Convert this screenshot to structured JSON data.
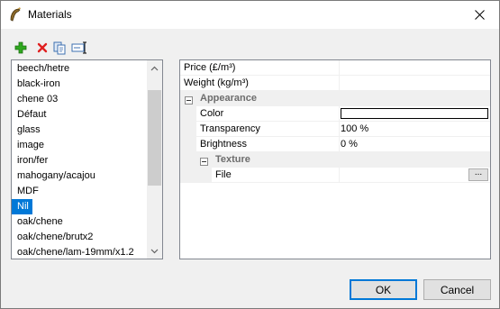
{
  "window": {
    "title": "Materials"
  },
  "toolbar": {
    "buttons": [
      "add-icon",
      "delete-icon",
      "copy-icon",
      "rename-icon"
    ]
  },
  "materials": {
    "items": [
      "beech/hetre",
      "black-iron",
      "chene 03",
      "Défaut",
      "glass",
      "image",
      "iron/fer",
      "mahogany/acajou",
      "MDF",
      "Nil",
      "oak/chene",
      "oak/chene/brutx2",
      "oak/chene/lam-19mm/x1.2"
    ],
    "selected": "Nil"
  },
  "properties": {
    "price_label": "Price (£/m³)",
    "price_value": "",
    "weight_label": "Weight (kg/m³)",
    "weight_value": "",
    "appearance_label": "Appearance",
    "color_label": "Color",
    "color_value": "#ffffff",
    "transparency_label": "Transparency",
    "transparency_value": "100 %",
    "brightness_label": "Brightness",
    "brightness_value": "0 %",
    "texture_label": "Texture",
    "file_label": "File",
    "file_value": "",
    "file_button": "..."
  },
  "buttons": {
    "ok": "OK",
    "cancel": "Cancel"
  },
  "colors": {
    "selection": "#0078d7",
    "add_icon": "#2fa81f",
    "delete_icon": "#e02020"
  }
}
